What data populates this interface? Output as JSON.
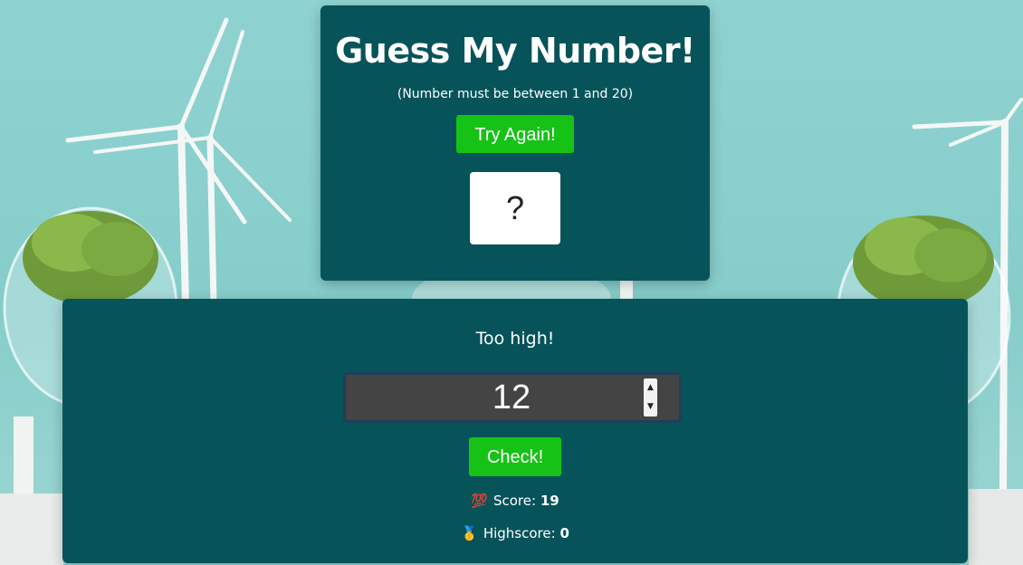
{
  "game": {
    "title": "Guess My Number!",
    "range_hint": "(Number must be between 1 and 20)",
    "try_again_label": "Try Again!",
    "secret_display": "?"
  },
  "play": {
    "message": "Too high!",
    "guess_value": "12",
    "check_label": "Check!",
    "score_label": "Score:",
    "score_value": "19",
    "highscore_label": "Highscore:",
    "highscore_value": "0"
  },
  "icons": {
    "score": "💯",
    "highscore": "🥇",
    "spin_up": "▲",
    "spin_down": "▼"
  },
  "colors": {
    "card": "#07535a",
    "button": "#16c216",
    "background": "#8ccfcd"
  }
}
